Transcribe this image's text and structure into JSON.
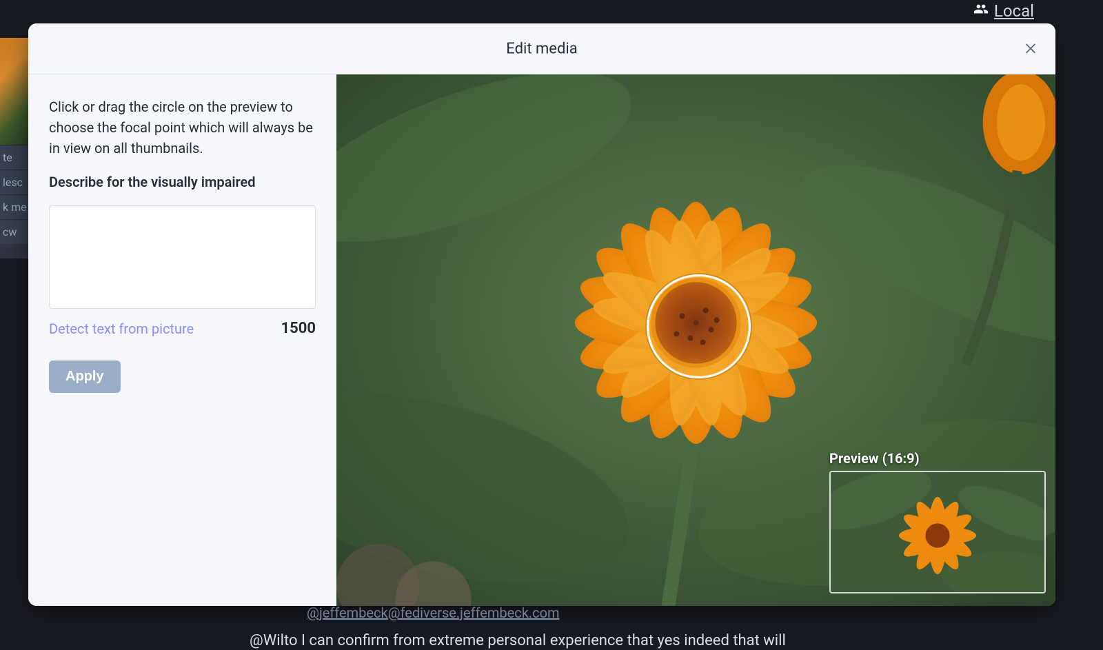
{
  "background": {
    "nav_local": "Local",
    "left_panel_rows": [
      "te",
      "lesc",
      "k me",
      "cw"
    ],
    "reply_handle": "@jeffembeck@fediverse.jeffembeck.com",
    "reply_text": "@Wilto I can confirm from extreme personal experience that yes indeed that will"
  },
  "modal": {
    "title": "Edit media",
    "hint_text": "Click or drag the circle on the preview to choose the focal point which will always be in view on all thumbnails.",
    "describe_label": "Describe for the visually impaired",
    "description_value": "",
    "detect_link": "Detect text from picture",
    "char_counter": "1500",
    "apply_label": "Apply",
    "preview_caption": "Preview (16:9)"
  }
}
